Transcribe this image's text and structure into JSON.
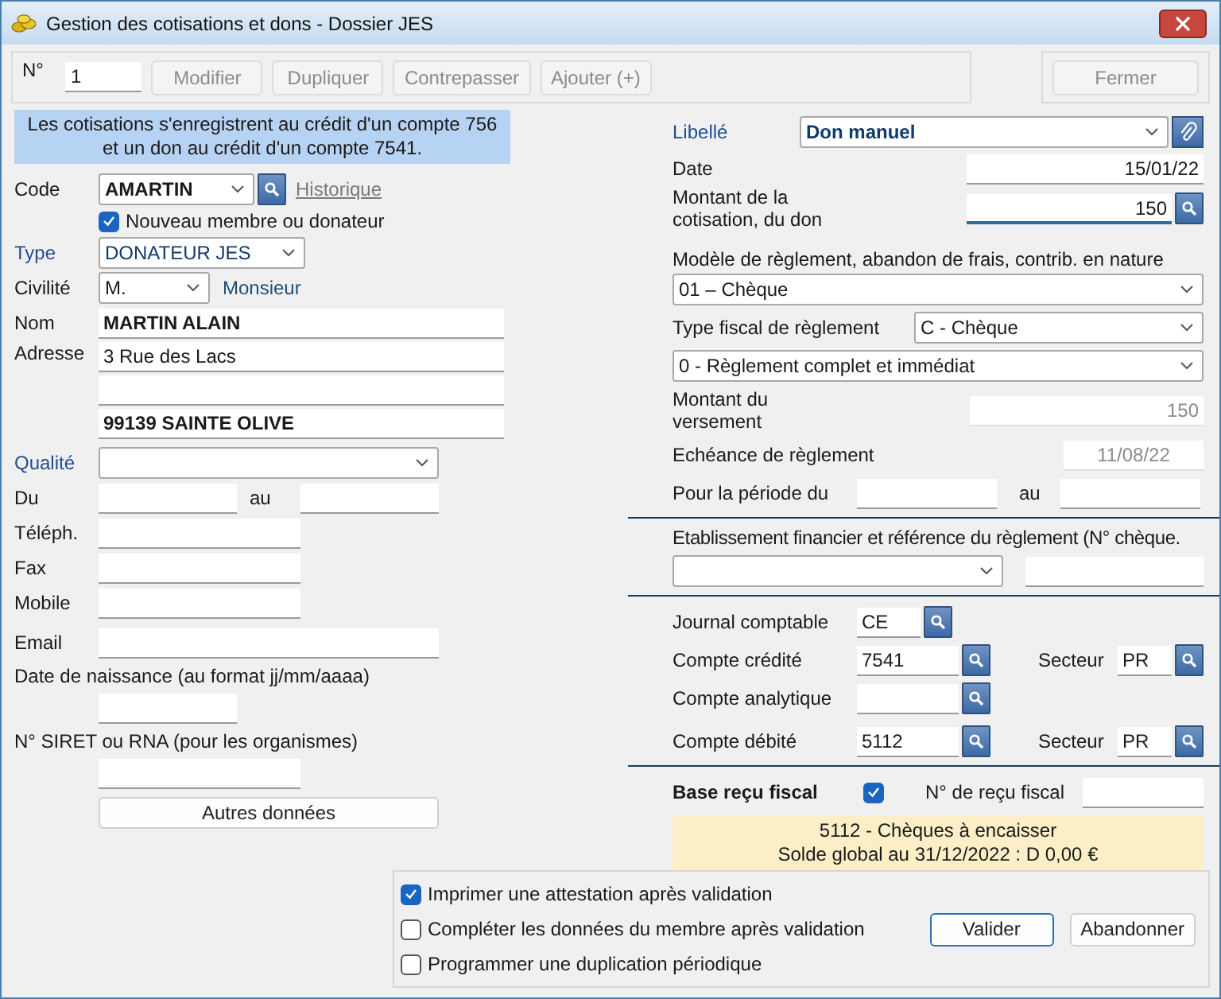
{
  "window": {
    "title": "Gestion des cotisations et dons - Dossier JES"
  },
  "toolbar": {
    "number_label": "N°",
    "number": "1",
    "buttons": [
      {
        "label": "Modifier",
        "disabled": true
      },
      {
        "label": "Dupliquer",
        "disabled": true
      },
      {
        "label": "Contrepasser",
        "disabled": true
      },
      {
        "label": "Ajouter (+)",
        "disabled": true
      }
    ],
    "close": {
      "label": "Fermer",
      "disabled": true
    }
  },
  "info_note": "Les cotisations s'enregistrent au crédit d'un compte 756 et un don au crédit d'un compte 7541.",
  "member": {
    "code": {
      "label": "Code",
      "value": "AMARTIN",
      "link": "Historique"
    },
    "new_member": {
      "label": "Nouveau membre ou donateur",
      "checked": true
    },
    "type": {
      "label": "Type",
      "value": "DONATEUR JES"
    },
    "civility": {
      "label": "Civilité",
      "value": "M.",
      "text": "Monsieur"
    },
    "name": {
      "label": "Nom",
      "value": "MARTIN ALAIN"
    },
    "address": {
      "label": "Adresse",
      "line_1": "3 Rue des Lacs",
      "line_3": "99139 SAINTE OLIVE"
    },
    "quality": {
      "label": "Qualité"
    },
    "period": {
      "label_from": "Du",
      "label_to": "au"
    },
    "phone": {
      "label": "Téléph."
    },
    "fax": {
      "label": "Fax"
    },
    "mobile": {
      "label": "Mobile"
    },
    "email": {
      "label": "Email"
    },
    "birth_date": {
      "label": "Date de naissance (au format jj/mm/aaaa)"
    },
    "siret": {
      "label": "N° SIRET ou RNA (pour les organismes)"
    },
    "more_button": "Autres données"
  },
  "entry": {
    "wording": {
      "label": "Libellé",
      "value": "Don manuel"
    },
    "date": {
      "label": "Date",
      "value": "15/01/22"
    },
    "amount": {
      "label": "Montant de la cotisation, du don",
      "value": "150"
    },
    "payment_model": {
      "label": "Modèle de règlement, abandon de frais, contrib. en nature",
      "value": "01 – Chèque"
    },
    "fiscal_type": {
      "label": "Type fiscal de règlement",
      "value": "C - Chèque"
    },
    "settlement": {
      "value": "0 - Règlement complet et immédiat"
    },
    "paid_amount": {
      "label": "Montant du versement",
      "value": "150",
      "disabled": true
    },
    "due_date": {
      "label": "Echéance de règlement",
      "value": "11/08/22",
      "disabled": true
    },
    "period": {
      "label_from": "Pour la période du",
      "label_to": "au"
    },
    "bank": {
      "label": "Etablissement financier et référence du règlement (N° chèque."
    },
    "journal": {
      "label": "Journal comptable",
      "value": "CE"
    },
    "credit_account": {
      "label": "Compte crédité",
      "value": "7541",
      "sector_label": "Secteur",
      "sector": "PR"
    },
    "analytic_account": {
      "label": "Compte analytique"
    },
    "debit_account": {
      "label": "Compte débité",
      "value": "5112",
      "sector_label": "Secteur",
      "sector": "PR"
    },
    "tax_receipt": {
      "label": "Base reçu fiscal",
      "checked": true,
      "number_label": "N° de reçu fiscal"
    },
    "account_info": [
      "5112 - Chèques à encaisser",
      "Solde global au 31/12/2022 : D 0,00 €"
    ]
  },
  "options": [
    {
      "label": "Imprimer une attestation après validation",
      "checked": true
    },
    {
      "label": "Compléter les données du membre après validation",
      "checked": false
    },
    {
      "label": "Programmer une duplication périodique",
      "checked": false
    }
  ],
  "actions": [
    {
      "label": "Valider",
      "default": true
    },
    {
      "label": "Abandonner",
      "default": false
    }
  ]
}
